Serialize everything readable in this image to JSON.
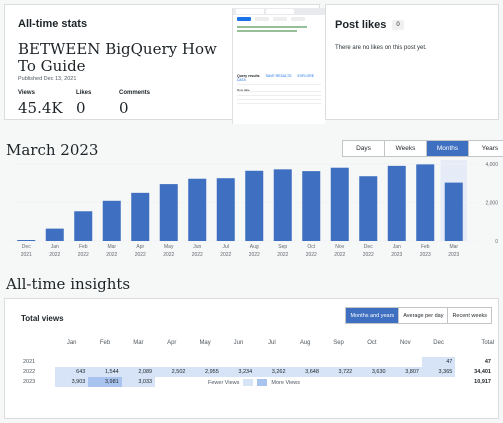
{
  "stats": {
    "heading": "All-time stats",
    "post_title": "BETWEEN BigQuery How To Guide",
    "published": "Published Dec 13, 2021",
    "views_label": "Views",
    "views_value": "45.4K",
    "likes_label": "Likes",
    "likes_value": "0",
    "comments_label": "Comments",
    "comments_value": "0"
  },
  "thumbnail": {
    "query_results": "Query results",
    "save": "SAVE RESULTS",
    "explore": "EXPLORE DATA",
    "row": "Row",
    "date": "date"
  },
  "likes": {
    "heading": "Post likes",
    "count": "0",
    "empty": "There are no likes on this post yet."
  },
  "chart_section": {
    "title": "March 2023",
    "tabs": [
      "Days",
      "Weeks",
      "Months",
      "Years"
    ],
    "active_tab": "Months"
  },
  "chart_data": {
    "type": "bar",
    "categories": [
      [
        "Dec",
        "2021"
      ],
      [
        "Jan",
        "2022"
      ],
      [
        "Feb",
        "2022"
      ],
      [
        "Mar",
        "2022"
      ],
      [
        "Apr",
        "2022"
      ],
      [
        "May",
        "2022"
      ],
      [
        "Jun",
        "2022"
      ],
      [
        "Jul",
        "2022"
      ],
      [
        "Aug",
        "2022"
      ],
      [
        "Sep",
        "2022"
      ],
      [
        "Oct",
        "2022"
      ],
      [
        "Nov",
        "2022"
      ],
      [
        "Dec",
        "2022"
      ],
      [
        "Jan",
        "2023"
      ],
      [
        "Feb",
        "2023"
      ],
      [
        "Mar",
        "2023"
      ]
    ],
    "values": [
      47,
      643,
      1544,
      2089,
      2502,
      2955,
      3234,
      3262,
      3648,
      3722,
      3630,
      3807,
      3365,
      3903,
      3981,
      3033
    ],
    "ylim": [
      0,
      4000
    ],
    "yticks": [
      0,
      2000,
      4000
    ],
    "ytick_labels": [
      "0",
      "2,000",
      "4,000"
    ],
    "highlight_index": 15,
    "bar_color": "#3e6fc0",
    "highlight_bg": "#e5ecf8"
  },
  "insights": {
    "title": "All-time insights",
    "heading": "Total views",
    "tabs": [
      "Months and years",
      "Average per day",
      "Recent weeks"
    ],
    "active_tab": "Months and years",
    "columns": [
      "",
      "Jan",
      "Feb",
      "Mar",
      "Apr",
      "May",
      "Jun",
      "Jul",
      "Aug",
      "Sep",
      "Oct",
      "Nov",
      "Dec",
      "Total"
    ],
    "rows": [
      {
        "year": "2021",
        "values": [
          "",
          "",
          "",
          "",
          "",
          "",
          "",
          "",
          "",
          "",
          "",
          "47"
        ],
        "total": "47"
      },
      {
        "year": "2022",
        "values": [
          "643",
          "1,544",
          "2,089",
          "2,502",
          "2,955",
          "3,234",
          "3,262",
          "3,648",
          "3,722",
          "3,630",
          "3,807",
          "3,365"
        ],
        "total": "34,401"
      },
      {
        "year": "2023",
        "values": [
          "3,903",
          "3,981",
          "3,033",
          "",
          "",
          "",
          "",
          "",
          "",
          "",
          "",
          ""
        ],
        "total": "10,917"
      }
    ],
    "legend_fewer": "Fewer Views",
    "legend_more": "More Views",
    "color_low": "#d7e4f7",
    "color_high": "#a7c3ee"
  }
}
